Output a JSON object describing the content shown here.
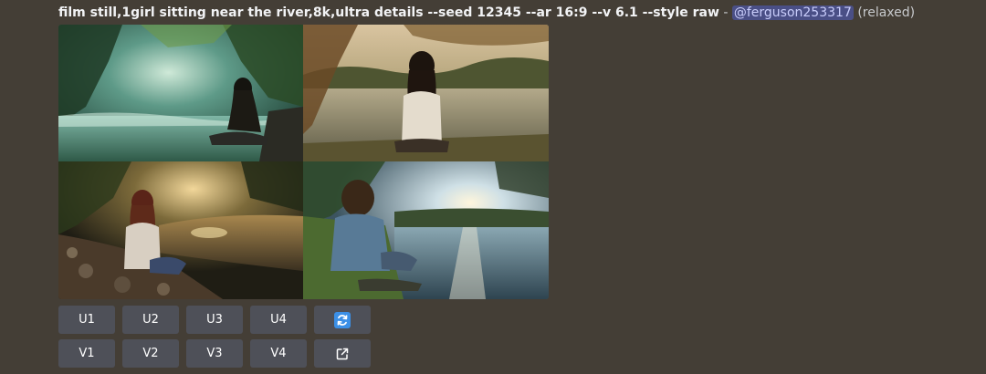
{
  "message": {
    "prompt": "film still,1girl sitting near the river,8k,ultra details --seed 12345 --ar 16:9 --v 6.1 --style raw",
    "separator": " - ",
    "mention": "@ferguson253317",
    "mode": "(relaxed)"
  },
  "images": [
    {
      "icon": "forest-stream-image"
    },
    {
      "icon": "lake-sunset-image"
    },
    {
      "icon": "rocky-riverbank-image"
    },
    {
      "icon": "sunlit-river-image"
    }
  ],
  "buttons": {
    "upscale": [
      "U1",
      "U2",
      "U3",
      "U4"
    ],
    "variation": [
      "V1",
      "V2",
      "V3",
      "V4"
    ],
    "reroll_icon": "refresh-icon",
    "open_icon": "external-link-icon"
  },
  "colors": {
    "background": "#443e36",
    "button": "#4e5058",
    "mention_bg": "#4a4f86",
    "reroll_blue": "#3b8fe6"
  }
}
